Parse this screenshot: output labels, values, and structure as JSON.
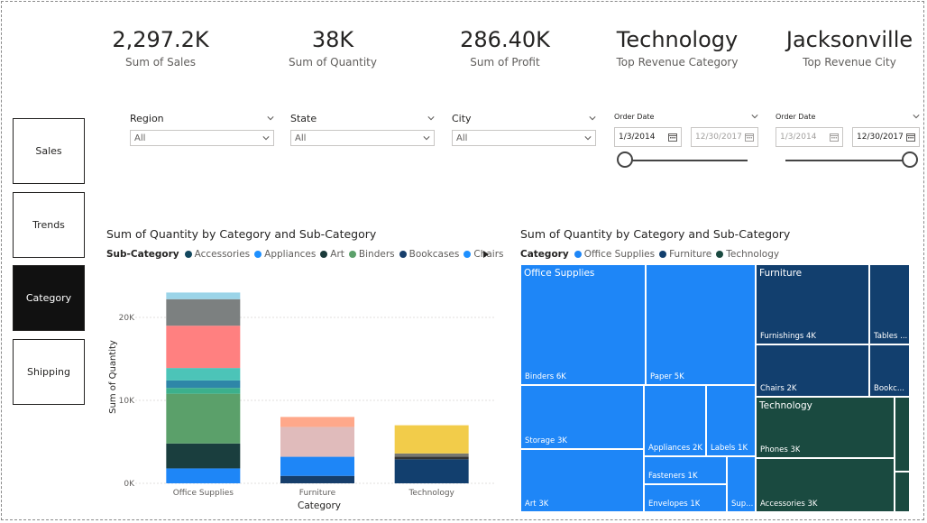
{
  "kpis": [
    {
      "value": "2,297.2K",
      "label": "Sum of Sales"
    },
    {
      "value": "38K",
      "label": "Sum of Quantity"
    },
    {
      "value": "286.40K",
      "label": "Sum of Profit"
    },
    {
      "value": "Technology",
      "label": "Top Revenue Category"
    },
    {
      "value": "Jacksonville",
      "label": "Top Revenue City"
    }
  ],
  "nav": [
    "Sales",
    "Trends",
    "Category",
    "Shipping"
  ],
  "nav_active": "Category",
  "slicers": [
    {
      "title": "Region",
      "value": "All"
    },
    {
      "title": "State",
      "value": "All"
    },
    {
      "title": "City",
      "value": "All"
    }
  ],
  "date_slicers": [
    {
      "title": "Order Date",
      "start": "1/3/2014",
      "end": "12/30/2017",
      "active": "start"
    },
    {
      "title": "Order Date",
      "start": "1/3/2014",
      "end": "12/30/2017",
      "active": "end"
    }
  ],
  "bar_chart": {
    "title": "Sum of Quantity by Category and Sub-Category",
    "legend_title": "Sub-Category",
    "legend": [
      {
        "name": "Accessories",
        "color": "#12475E"
      },
      {
        "name": "Appliances",
        "color": "#1E90FF"
      },
      {
        "name": "Art",
        "color": "#1A3A3A"
      },
      {
        "name": "Binders",
        "color": "#5BA06A"
      },
      {
        "name": "Bookcases",
        "color": "#163E6B"
      },
      {
        "name": "Chairs",
        "color": "#1E90FF"
      }
    ]
  },
  "treemap": {
    "title": "Sum of Quantity by Category and Sub-Category",
    "legend_title": "Category",
    "legend": [
      {
        "name": "Office Supplies",
        "color": "#1E86F7"
      },
      {
        "name": "Furniture",
        "color": "#123F6E"
      },
      {
        "name": "Technology",
        "color": "#1A4A40"
      }
    ],
    "cells": [
      {
        "label": "Binders 6K",
        "value": 6000,
        "category": "Office Supplies"
      },
      {
        "label": "Paper 5K",
        "value": 5000,
        "category": "Office Supplies"
      },
      {
        "label": "Storage 3K",
        "value": 3000,
        "category": "Office Supplies"
      },
      {
        "label": "Art 3K",
        "value": 3000,
        "category": "Office Supplies"
      },
      {
        "label": "Appliances 2K",
        "value": 2000,
        "category": "Office Supplies"
      },
      {
        "label": "Labels 1K",
        "value": 1000,
        "category": "Office Supplies"
      },
      {
        "label": "Fasteners 1K",
        "value": 1000,
        "category": "Office Supplies"
      },
      {
        "label": "Envelopes 1K",
        "value": 1000,
        "category": "Office Supplies"
      },
      {
        "label": "Sup...",
        "category": "Office Supplies"
      },
      {
        "label": "Furnishings 4K",
        "value": 4000,
        "category": "Furniture"
      },
      {
        "label": "Tables ...",
        "category": "Furniture"
      },
      {
        "label": "Chairs 2K",
        "value": 2000,
        "category": "Furniture"
      },
      {
        "label": "Bookc...",
        "category": "Furniture"
      },
      {
        "label": "Phones 3K",
        "value": 3000,
        "category": "Technology"
      },
      {
        "label": "Accessories 3K",
        "value": 3000,
        "category": "Technology"
      }
    ]
  },
  "chart_data": {
    "type": "bar",
    "stacked": true,
    "title": "Sum of Quantity by Category and Sub-Category",
    "xlabel": "Category",
    "ylabel": "Sum of Quantity",
    "ylim": [
      0,
      25000
    ],
    "yticks": [
      0,
      10000,
      20000
    ],
    "ytick_labels": [
      "0K",
      "10K",
      "20K"
    ],
    "categories": [
      "Office Supplies",
      "Furniture",
      "Technology"
    ],
    "legend_position": "top",
    "grid": true,
    "stacks": [
      [
        {
          "value": 1800,
          "color": "#1E86F7"
        },
        {
          "value": 3000,
          "color": "#1A3E3E"
        },
        {
          "value": 6000,
          "color": "#5BA06A"
        },
        {
          "value": 700,
          "color": "#3CB08C"
        },
        {
          "value": 900,
          "color": "#2E86A8"
        },
        {
          "value": 1500,
          "color": "#4CC4B8"
        },
        {
          "value": 5100,
          "color": "#FF8080"
        },
        {
          "value": 3200,
          "color": "#7C8080"
        },
        {
          "value": 800,
          "color": "#9BD4E8"
        }
      ],
      [
        {
          "value": 900,
          "color": "#163E6B"
        },
        {
          "value": 2300,
          "color": "#1E86F7"
        },
        {
          "value": 3600,
          "color": "#E0BBBB"
        },
        {
          "value": 1200,
          "color": "#FFA88A"
        }
      ],
      [
        {
          "value": 2900,
          "color": "#123F6E"
        },
        {
          "value": 300,
          "color": "#333333"
        },
        {
          "value": 400,
          "color": "#777770"
        },
        {
          "value": 3400,
          "color": "#F2CC4A"
        }
      ]
    ]
  }
}
